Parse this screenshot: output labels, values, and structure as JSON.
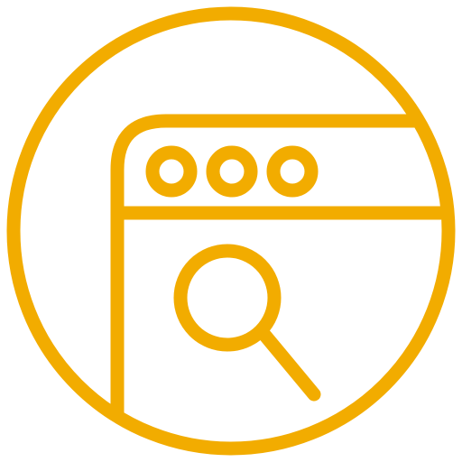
{
  "icon": {
    "name": "browser-search-icon",
    "accent_color": "#F2AC00",
    "background_color": "#FFFFFF",
    "parts": {
      "outer": "circle-outline",
      "window": "browser-window-outline",
      "title_dots": 3,
      "content": "magnifying-glass"
    }
  }
}
